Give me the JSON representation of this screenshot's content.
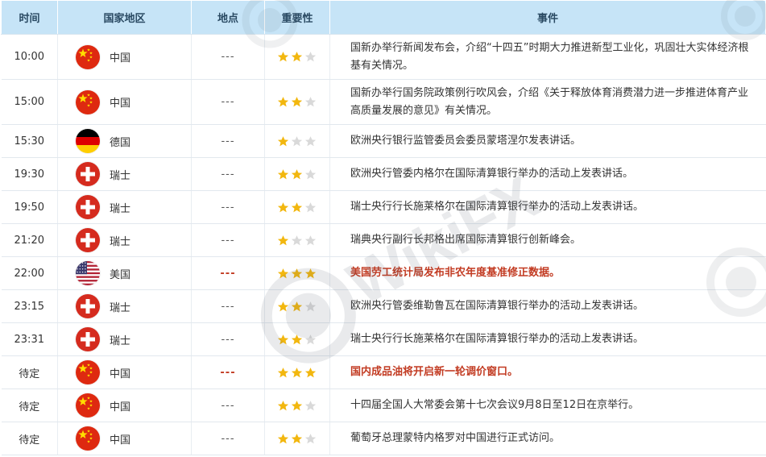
{
  "header": {
    "time": "时间",
    "country": "国家地区",
    "place": "地点",
    "importance": "重要性",
    "event": "事件"
  },
  "colors": {
    "header_bg": "#c6e4f7",
    "highlight_text": "#c23b22",
    "star_on": "#f2b70f",
    "star_off": "#d9d9d9"
  },
  "watermark_text": "WikiFX",
  "rows": [
    {
      "time": "10:00",
      "country": "中国",
      "flag": "china-flag-icon",
      "place": "---",
      "stars": 2,
      "highlight": false,
      "event": "国新办举行新闻发布会，介绍“十四五”时期大力推进新型工业化，巩固壮大实体经济根基有关情况。"
    },
    {
      "time": "15:00",
      "country": "中国",
      "flag": "china-flag-icon",
      "place": "---",
      "stars": 2,
      "highlight": false,
      "event": "国新办举行国务院政策例行吹风会，介绍《关于释放体育消费潜力进一步推进体育产业高质量发展的意见》有关情况。"
    },
    {
      "time": "15:30",
      "country": "德国",
      "flag": "germany-flag-icon",
      "place": "---",
      "stars": 1,
      "highlight": false,
      "event": "欧洲央行银行监管委员会委员蒙塔涅尔发表讲话。"
    },
    {
      "time": "19:30",
      "country": "瑞士",
      "flag": "switzerland-flag-icon",
      "place": "---",
      "stars": 2,
      "highlight": false,
      "event": "欧洲央行管委内格尔在国际清算银行举办的活动上发表讲话。"
    },
    {
      "time": "19:50",
      "country": "瑞士",
      "flag": "switzerland-flag-icon",
      "place": "---",
      "stars": 2,
      "highlight": false,
      "event": "瑞士央行行长施莱格尔在国际清算银行举办的活动上发表讲话。"
    },
    {
      "time": "21:20",
      "country": "瑞士",
      "flag": "switzerland-flag-icon",
      "place": "---",
      "stars": 1,
      "highlight": false,
      "event": "瑞典央行副行长邦格出席国际清算银行创新峰会。"
    },
    {
      "time": "22:00",
      "country": "美国",
      "flag": "usa-flag-icon",
      "place": "---",
      "stars": 3,
      "highlight": true,
      "event": "美国劳工统计局发布非农年度基准修正数据。"
    },
    {
      "time": "23:15",
      "country": "瑞士",
      "flag": "switzerland-flag-icon",
      "place": "---",
      "stars": 2,
      "highlight": false,
      "event": "欧洲央行管委维勒鲁瓦在国际清算银行举办的活动上发表讲话。"
    },
    {
      "time": "23:31",
      "country": "瑞士",
      "flag": "switzerland-flag-icon",
      "place": "---",
      "stars": 2,
      "highlight": false,
      "event": "瑞士央行行长施莱格尔在国际清算银行举办的活动上发表讲话。"
    },
    {
      "time": "待定",
      "country": "中国",
      "flag": "china-flag-icon",
      "place": "---",
      "stars": 3,
      "highlight": true,
      "event": "国内成品油将开启新一轮调价窗口。"
    },
    {
      "time": "待定",
      "country": "中国",
      "flag": "china-flag-icon",
      "place": "---",
      "stars": 2,
      "highlight": false,
      "event": "十四届全国人大常委会第十七次会议9月8日至12日在京举行。"
    },
    {
      "time": "待定",
      "country": "中国",
      "flag": "china-flag-icon",
      "place": "---",
      "stars": 2,
      "highlight": false,
      "event": "葡萄牙总理蒙特内格罗对中国进行正式访问。"
    }
  ]
}
